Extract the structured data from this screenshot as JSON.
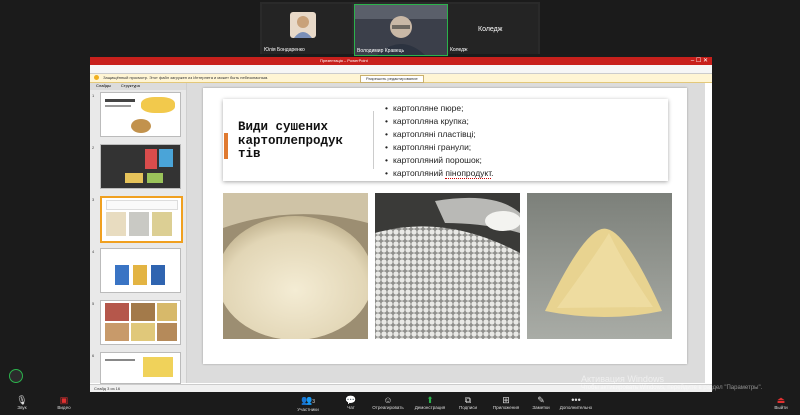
{
  "meeting": {
    "participants": [
      {
        "name": "Юлія Бондаренко",
        "video": "photo"
      },
      {
        "name": "Володимир Кравець",
        "video": "camera"
      },
      {
        "name": "Коледж",
        "video": "off"
      }
    ]
  },
  "ppt": {
    "title": "Презентація – PowerPoint",
    "ribbon_tabs": [
      "Файл",
      "Главная",
      "Вставка",
      "Дизайн",
      "Переходы",
      "Анимация",
      "Показ слайдов",
      "Рецензирование",
      "Вид"
    ],
    "security_warning": "Защищённый просмотр. Этот файл загружен из Интернета и может быть небезопасным.",
    "security_button": "Разрешить редактирование",
    "panel_tabs": [
      "Слайды",
      "Структура"
    ],
    "status_text": "Слайд 3 из 16",
    "slide_numbers": [
      "1",
      "2",
      "3",
      "4",
      "5",
      "6"
    ]
  },
  "slide": {
    "title": "Види сушених картоплепродуктів",
    "title_lines": [
      "Види сушених",
      "картоплепродук",
      "тів"
    ],
    "items": [
      "картопляне пюре;",
      "картопляна крупка;",
      "картопляні пластівці;",
      "картопляні гранули;",
      "картопляний порошок;",
      "картопляний "
    ],
    "last_item_underlined": "пінопродукт",
    "last_item_end": ".",
    "images": [
      "dried-potato-flakes-sack",
      "potato-granules-scoop",
      "potato-powder-pile"
    ]
  },
  "toolbar": {
    "items": [
      {
        "label": "Звук",
        "icon": "mic-icon"
      },
      {
        "label": "Видео",
        "icon": "video-off-icon"
      },
      {
        "label": "Участники",
        "icon": "participants-icon",
        "count": "3"
      },
      {
        "label": "Чат",
        "icon": "chat-icon"
      },
      {
        "label": "Отреагировать",
        "icon": "react-icon"
      },
      {
        "label": "Демонстрация",
        "icon": "share-icon"
      },
      {
        "label": "Подписи",
        "icon": "captions-icon"
      },
      {
        "label": "Приложения",
        "icon": "apps-icon"
      },
      {
        "label": "Заметки",
        "icon": "notes-icon"
      },
      {
        "label": "Дополнительно",
        "icon": "more-icon"
      },
      {
        "label": "Выйти",
        "icon": "leave-icon"
      }
    ],
    "accent_color": "#2bb24c",
    "leave_color": "#e03030"
  },
  "watermark": {
    "line1": "Активация Windows",
    "line2": "Чтобы активировать Windows, перейдите в раздел \"Параметры\"."
  }
}
